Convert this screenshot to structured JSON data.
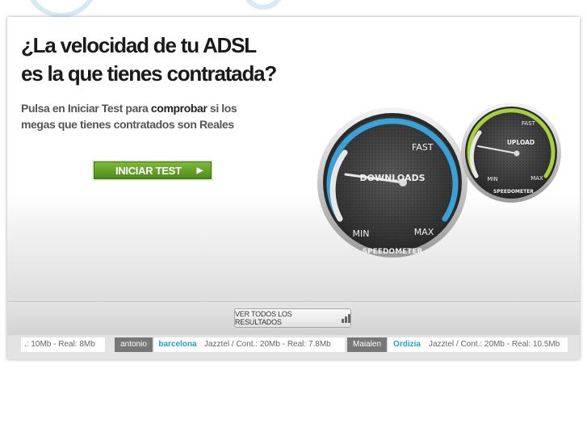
{
  "hero": {
    "headline_line1": "¿La velocidad de tu ADSL",
    "headline_line2": "es la que tienes contratada?",
    "sub_part1": "Pulsa en Iniciar Test para ",
    "sub_strong": "comprobar",
    "sub_part2": " si los megas que tienes contratados son Reales",
    "start_button": "INICIAR TEST",
    "start_arrow": "▶"
  },
  "speedometer_download": {
    "title": "DOWNLOADS",
    "label_fast": "FAST",
    "label_min": "MIN",
    "label_max": "MAX",
    "brand": "SPEEDOMETER",
    "accent": "#3aa7e2"
  },
  "speedometer_upload": {
    "title": "UPLOAD",
    "label_fast": "FAST",
    "label_min": "MIN",
    "label_max": "MAX",
    "brand": "SPEEDOMETER",
    "accent": "#a6d13a"
  },
  "results": {
    "button_label": "VER TODOS LOS RESULTADOS",
    "icon": "bar-chart-icon"
  },
  "ticker": [
    {
      "info": ".: 10Mb - Real: 8Mb"
    },
    {
      "name": "antonio",
      "city": "barcelona",
      "info": "Jazztel / Cont.: 20Mb - Real: 7.8Mb"
    },
    {
      "name": "Maialen",
      "city": "Ordizia",
      "info": "Jazztel / Cont.: 20Mb - Real: 10.5Mb"
    }
  ]
}
